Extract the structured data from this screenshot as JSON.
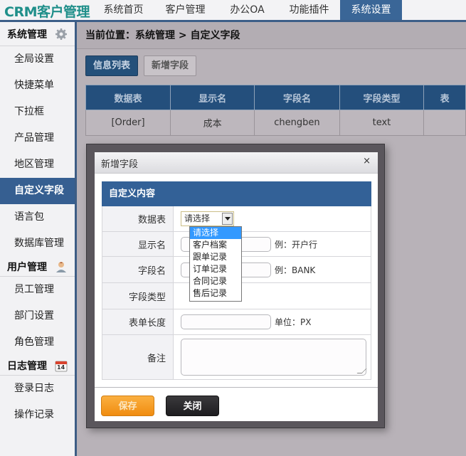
{
  "app": {
    "logo": "CRM客户管理"
  },
  "nav": {
    "items": [
      {
        "label": "系统首页",
        "active": false
      },
      {
        "label": "客户管理",
        "active": false
      },
      {
        "label": "办公OA",
        "active": false
      },
      {
        "label": "功能插件",
        "active": false
      },
      {
        "label": "系统设置",
        "active": true
      }
    ]
  },
  "sidebar": {
    "groups": [
      {
        "title": "系统管理",
        "icon": "gear-icon",
        "items": [
          "全局设置",
          "快捷菜单",
          "下拉框",
          "产品管理",
          "地区管理",
          "自定义字段",
          "语言包",
          "数据库管理"
        ]
      },
      {
        "title": "用户管理",
        "icon": "user-icon",
        "items": [
          "员工管理",
          "部门设置",
          "角色管理"
        ]
      },
      {
        "title": "日志管理",
        "icon": "calendar-icon",
        "icon_text": "14",
        "items": [
          "登录日志",
          "操作记录"
        ]
      }
    ],
    "active_item": "自定义字段"
  },
  "main": {
    "breadcrumb": "当前位置：系统管理 > 自定义字段",
    "tabs": [
      {
        "label": "信息列表",
        "active": true
      },
      {
        "label": "新增字段",
        "active": false
      }
    ],
    "table": {
      "headers": [
        "数据表",
        "显示名",
        "字段名",
        "字段类型",
        "表"
      ],
      "rows": [
        [
          "[Order]",
          "成本",
          "chengben",
          "text",
          ""
        ]
      ]
    }
  },
  "modal": {
    "title": "新增字段",
    "close": "×",
    "section": "自定义内容",
    "fields": {
      "table": {
        "label": "数据表",
        "value": "请选择"
      },
      "display_name": {
        "label": "显示名",
        "value": "",
        "hint": "例：开户行"
      },
      "field_name": {
        "label": "字段名",
        "value": "",
        "hint": "例：BANK"
      },
      "field_type": {
        "label": "字段类型"
      },
      "form_length": {
        "label": "表单长度",
        "value": "",
        "hint": "单位：PX"
      },
      "remark": {
        "label": "备注",
        "value": ""
      }
    },
    "dropdown_options": [
      "请选择",
      "客户档案",
      "跟单记录",
      "订单记录",
      "合同记录",
      "售后记录"
    ],
    "buttons": {
      "save": "保存",
      "close": "关闭"
    }
  }
}
